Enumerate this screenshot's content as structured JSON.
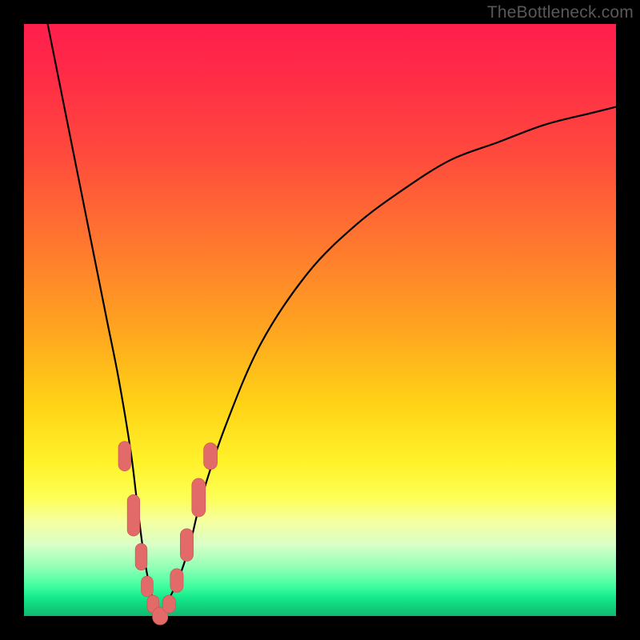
{
  "watermark": "TheBottleneck.com",
  "colors": {
    "frame": "#000000",
    "curve": "#000000",
    "marker_fill": "#e26a68",
    "marker_stroke": "#c7514f"
  },
  "chart_data": {
    "type": "line",
    "title": "",
    "xlabel": "",
    "ylabel": "",
    "xlim": [
      0,
      100
    ],
    "ylim": [
      0,
      100
    ],
    "grid": false,
    "legend": false,
    "series": [
      {
        "name": "bottleneck-curve",
        "x": [
          4,
          6,
          8,
          10,
          12,
          14,
          16,
          18,
          19,
          20,
          21,
          22,
          23,
          24,
          26,
          28,
          30,
          34,
          40,
          48,
          56,
          64,
          72,
          80,
          88,
          96,
          100
        ],
        "y": [
          100,
          90,
          80,
          70,
          60,
          50,
          40,
          28,
          20,
          12,
          6,
          2,
          0,
          2,
          6,
          12,
          20,
          32,
          46,
          58,
          66,
          72,
          77,
          80,
          83,
          85,
          86
        ]
      }
    ],
    "markers": [
      {
        "x": 17.0,
        "y": 27,
        "w": 2.1,
        "h": 5.0
      },
      {
        "x": 18.5,
        "y": 17,
        "w": 2.1,
        "h": 7.0
      },
      {
        "x": 19.8,
        "y": 10,
        "w": 2.0,
        "h": 4.5
      },
      {
        "x": 20.8,
        "y": 5,
        "w": 2.0,
        "h": 3.5
      },
      {
        "x": 21.8,
        "y": 2,
        "w": 2.0,
        "h": 3.0
      },
      {
        "x": 23.0,
        "y": 0,
        "w": 2.6,
        "h": 3.0
      },
      {
        "x": 24.5,
        "y": 2,
        "w": 2.2,
        "h": 3.0
      },
      {
        "x": 25.8,
        "y": 6,
        "w": 2.2,
        "h": 4.0
      },
      {
        "x": 27.5,
        "y": 12,
        "w": 2.2,
        "h": 5.5
      },
      {
        "x": 29.5,
        "y": 20,
        "w": 2.3,
        "h": 6.5
      },
      {
        "x": 31.5,
        "y": 27,
        "w": 2.3,
        "h": 4.5
      }
    ]
  }
}
